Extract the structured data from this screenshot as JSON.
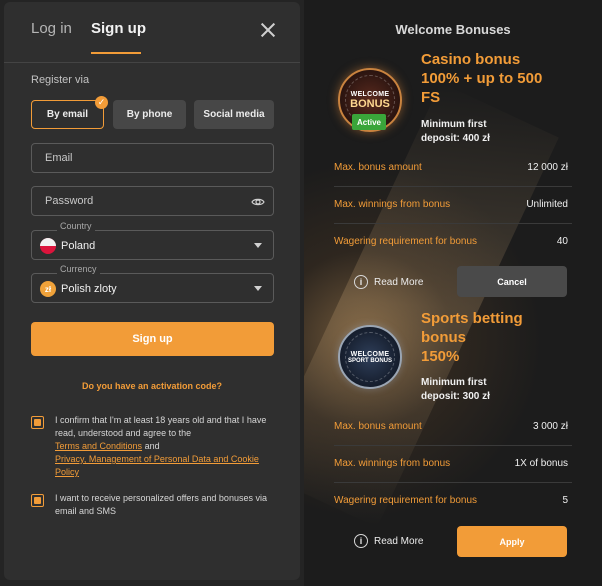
{
  "auth": {
    "tabs": [
      {
        "label": "Log in",
        "active": false
      },
      {
        "label": "Sign up",
        "active": true
      }
    ],
    "register_via_label": "Register via",
    "methods": [
      {
        "label": "By email",
        "active": true
      },
      {
        "label": "By phone",
        "active": false
      },
      {
        "label": "Social media",
        "active": false
      }
    ],
    "email_placeholder": "Email",
    "password_placeholder": "Password",
    "country": {
      "label": "Country",
      "value": "Poland"
    },
    "currency": {
      "label": "Currency",
      "value": "Polish zloty",
      "symbol": "zł"
    },
    "signup_button": "Sign up",
    "activation_link": "Do you have an activation code?",
    "consent": {
      "text_1": "I confirm that I'm at least 18 years old and that I have read, understood and agree to the",
      "terms_link": "Terms and Conditions",
      "and": "and",
      "privacy_link": "Privacy, Management of Personal Data and Cookie Policy",
      "checked": true
    },
    "offers": {
      "text": "I want to receive personalized offers and bonuses via email and SMS",
      "checked": true
    }
  },
  "bonuses": {
    "title": "Welcome Bonuses",
    "items": [
      {
        "coin_line1": "WELCOME",
        "coin_line2": "BONUS",
        "badge": "Active",
        "title_lines": [
          "Casino bonus",
          "100% + up to 500",
          "FS"
        ],
        "min_deposit_lines": [
          "Minimum first",
          "deposit: 400 zł"
        ],
        "rows": [
          {
            "key": "Max. bonus amount",
            "value": "12 000 zł"
          },
          {
            "key": "Max. winnings from bonus",
            "value": "Unlimited"
          },
          {
            "key": "Wagering requirement for bonus",
            "value": "40"
          }
        ],
        "read_more": "Read More",
        "action": "Cancel"
      },
      {
        "coin_line1": "WELCOME",
        "coin_line2": "SPORT BONUS",
        "title_lines": [
          "Sports betting",
          "bonus",
          "150%"
        ],
        "min_deposit_lines": [
          "Minimum first",
          "deposit: 300 zł"
        ],
        "rows": [
          {
            "key": "Max. bonus amount",
            "value": "3 000 zł"
          },
          {
            "key": "Max. winnings from bonus",
            "value": "1X of bonus"
          },
          {
            "key": "Wagering requirement for bonus",
            "value": "5"
          }
        ],
        "read_more": "Read More",
        "action": "Apply"
      }
    ]
  },
  "colors": {
    "accent": "#f29c38",
    "active_badge": "#3aa53a"
  },
  "icons": [
    "close-icon",
    "check-icon",
    "eye-icon",
    "poland-flag-icon",
    "zloty-icon",
    "chevron-down-icon",
    "info-icon"
  ]
}
